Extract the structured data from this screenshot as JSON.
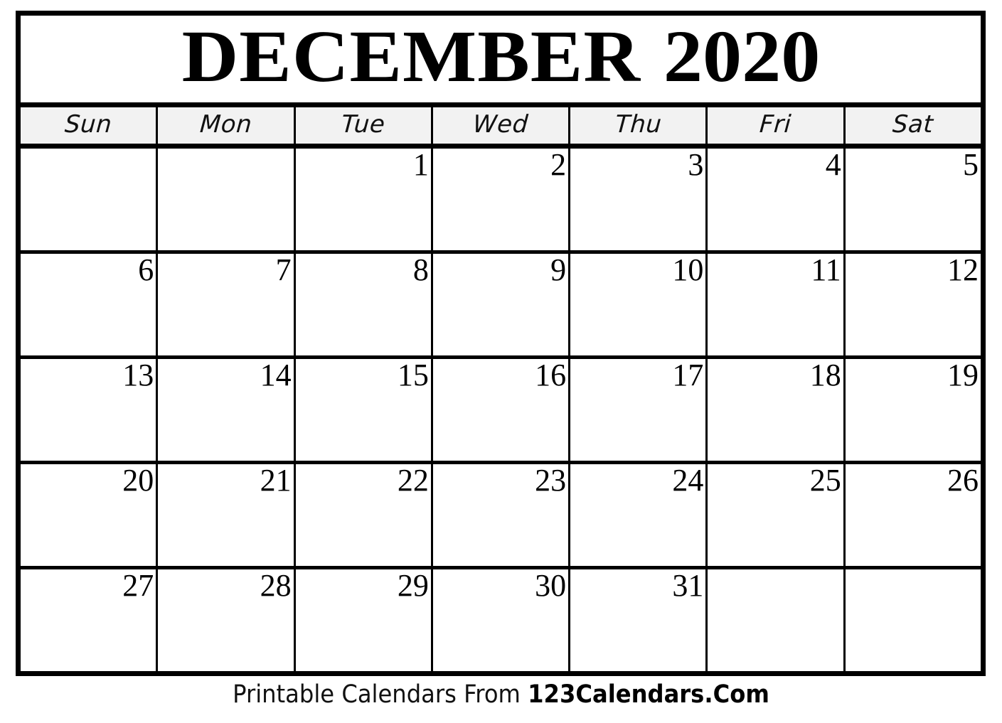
{
  "calendar": {
    "month_name": "DECEMBER",
    "year": "2020",
    "title_full": "DECEMBER 2020",
    "weekdays": [
      {
        "short": "Sun"
      },
      {
        "short": "Mon"
      },
      {
        "short": "Tue"
      },
      {
        "short": "Wed"
      },
      {
        "short": "Thu"
      },
      {
        "short": "Fri"
      },
      {
        "short": "Sat"
      }
    ],
    "weeks": [
      {
        "days": [
          {
            "num": ""
          },
          {
            "num": ""
          },
          {
            "num": "1"
          },
          {
            "num": "2"
          },
          {
            "num": "3"
          },
          {
            "num": "4"
          },
          {
            "num": "5"
          }
        ]
      },
      {
        "days": [
          {
            "num": "6"
          },
          {
            "num": "7"
          },
          {
            "num": "8"
          },
          {
            "num": "9"
          },
          {
            "num": "10"
          },
          {
            "num": "11"
          },
          {
            "num": "12"
          }
        ]
      },
      {
        "days": [
          {
            "num": "13"
          },
          {
            "num": "14"
          },
          {
            "num": "15"
          },
          {
            "num": "16"
          },
          {
            "num": "17"
          },
          {
            "num": "18"
          },
          {
            "num": "19"
          }
        ]
      },
      {
        "days": [
          {
            "num": "20"
          },
          {
            "num": "21"
          },
          {
            "num": "22"
          },
          {
            "num": "23"
          },
          {
            "num": "24"
          },
          {
            "num": "25"
          },
          {
            "num": "26"
          }
        ]
      },
      {
        "days": [
          {
            "num": "27"
          },
          {
            "num": "28"
          },
          {
            "num": "29"
          },
          {
            "num": "30"
          },
          {
            "num": "31"
          },
          {
            "num": ""
          },
          {
            "num": ""
          }
        ]
      }
    ]
  },
  "footer": {
    "prefix": "Printable Calendars From ",
    "brand": "123Calendars.Com"
  },
  "colors": {
    "border": "#000000",
    "weekday_header_bg": "#f2f2f2",
    "page_bg": "#ffffff",
    "text": "#000000"
  }
}
